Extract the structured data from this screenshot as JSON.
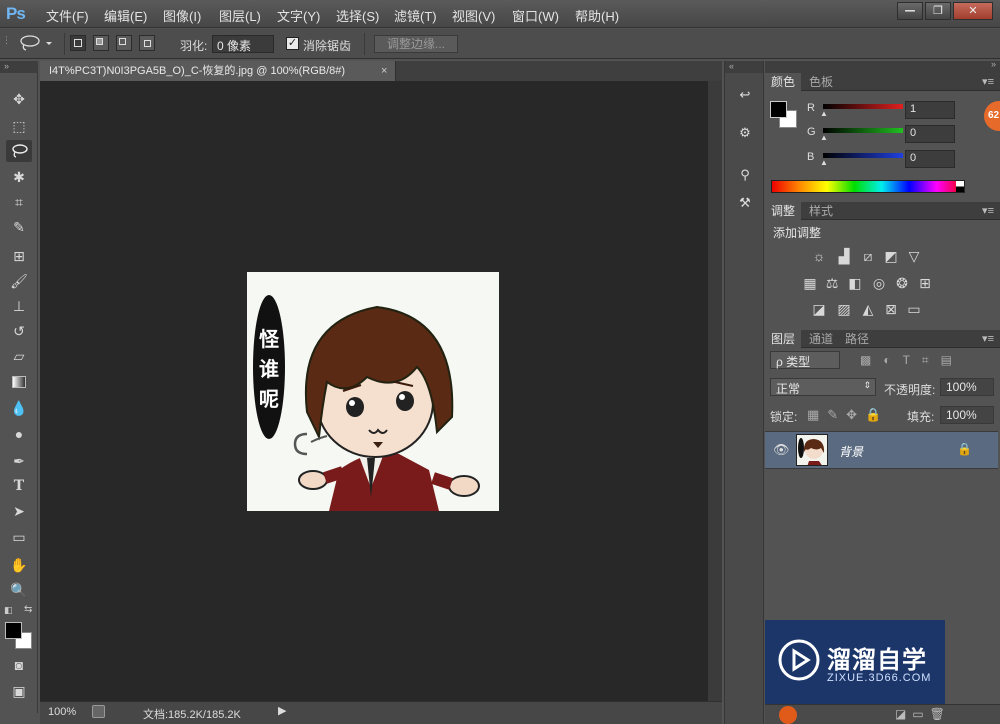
{
  "app": {
    "logo": "Ps"
  },
  "menu": [
    "文件(F)",
    "编辑(E)",
    "图像(I)",
    "图层(L)",
    "文字(Y)",
    "选择(S)",
    "滤镜(T)",
    "视图(V)",
    "窗口(W)",
    "帮助(H)"
  ],
  "window_controls": {
    "minimize": "—",
    "restore": "❐",
    "close": "✕"
  },
  "options_bar": {
    "feather_label": "羽化:",
    "feather_value": "0 像素",
    "antialias_label": "消除锯齿",
    "antialias_checked": true,
    "refine_edge_label": "调整边缘..."
  },
  "document": {
    "tab_title": "I4T%PC3T)N0I3PGA5B_O)_C-恢复的.jpg @ 100%(RGB/8#)",
    "tab_close": "×",
    "image_text": [
      "怪",
      "谁",
      "呢"
    ]
  },
  "status": {
    "zoom": "100%",
    "doc_info": "文档:185.2K/185.2K"
  },
  "color_panel": {
    "tabs": [
      "颜色",
      "色板"
    ],
    "channels": [
      {
        "label": "R",
        "value": "1"
      },
      {
        "label": "G",
        "value": "0"
      },
      {
        "label": "B",
        "value": "0"
      }
    ]
  },
  "adjust_panel": {
    "tabs": [
      "调整",
      "样式"
    ],
    "heading": "添加调整"
  },
  "layers_panel": {
    "tabs": [
      "图层",
      "通道",
      "路径"
    ],
    "filter_label": "ρ 类型",
    "blend_mode": "正常",
    "opacity_label": "不透明度:",
    "opacity_value": "100%",
    "lock_label": "锁定:",
    "fill_label": "填充:",
    "fill_value": "100%",
    "layers": [
      {
        "name": "背景",
        "locked": true,
        "visible": true
      }
    ]
  },
  "watermark": {
    "brand": "溜溜自学",
    "url": "ZIXUE.3D66.COM"
  },
  "badge": "62",
  "colors": {
    "accent_blue": "#6fb6f2",
    "foreground": "#000000",
    "background": "#ffffff",
    "layer_selected": "#5a6a80"
  }
}
